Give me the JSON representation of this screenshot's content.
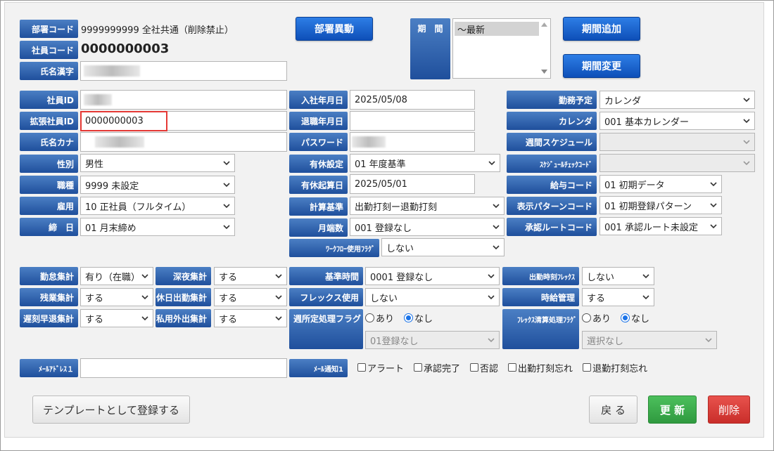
{
  "header": {
    "dept_code_label": "部署コード",
    "dept_code_value": "9999999999  全社共通（削除禁止）",
    "emp_code_label": "社員コード",
    "emp_code_value": "0000000003",
    "name_kanji_label": "氏名漢字",
    "dept_transfer_button": "部署異動",
    "period_label": "期　間",
    "period_option": "～最新",
    "add_period_button": "期間追加",
    "change_period_button": "期間変更"
  },
  "col1": {
    "emp_id_label": "社員ID",
    "ext_emp_id_label": "拡張社員ID",
    "ext_emp_id_value": "0000000003",
    "name_kana_label": "氏名カナ",
    "gender_label": "性別",
    "gender_value": "男性",
    "job_label": "職種",
    "job_value": "9999 未設定",
    "employment_label": "雇用",
    "employment_value": "10 正社員（フルタイム）",
    "closing_label": "締　日",
    "closing_value": "01 月末締め"
  },
  "col2": {
    "hire_date_label": "入社年月日",
    "hire_date_value": "2025/05/08",
    "retire_date_label": "退職年月日",
    "password_label": "パスワード",
    "paid_leave_label": "有休設定",
    "paid_leave_value": "01 年度基準",
    "paid_leave_start_label": "有休起算日",
    "paid_leave_start_value": "2025/05/01",
    "calc_basis_label": "計算基準",
    "calc_basis_value": "出勤打刻ー退勤打刻",
    "month_end_label": "月端数",
    "month_end_value": "001 登録なし",
    "workflow_label": "ﾜｰｸﾌﾛｰ使用ﾌﾗｸﾞ",
    "workflow_value": "しない"
  },
  "col3": {
    "work_schedule_label": "勤務予定",
    "work_schedule_value": "カレンダ",
    "calendar_label": "カレンダ",
    "calendar_value": "001 基本カレンダー",
    "weekly_schedule_label": "週間スケジュール",
    "schedule_check_label": "ｽｹｼﾞｭｰﾙﾁｪｯｸｺｰﾄﾞ",
    "salary_code_label": "給与コード",
    "salary_code_value": "01 初期データ",
    "display_pattern_label": "表示パターンコード",
    "display_pattern_value": "01 初期登録パターン",
    "approval_route_label": "承認ルートコード",
    "approval_route_value": "001 承認ルート未設定"
  },
  "aggregation": {
    "attendance_label": "勤怠集計",
    "attendance_value": "有り（在職）",
    "late_night_label": "深夜集計",
    "late_night_value": "する",
    "overtime_label": "残業集計",
    "overtime_value": "する",
    "holiday_work_label": "休日出勤集計",
    "holiday_work_value": "する",
    "late_early_label": "遅刻早退集計",
    "late_early_value": "する",
    "private_out_label": "私用外出集計",
    "private_out_value": "する",
    "base_time_label": "基準時間",
    "base_time_value": "0001 登録なし",
    "flex_use_label": "フレックス使用",
    "flex_use_value": "しない",
    "weekly_fixed_label": "週所定処理フラグ",
    "weekly_fixed_yes": "あり",
    "weekly_fixed_no": "なし",
    "weekly_fixed_select": "01登録なし",
    "clock_flex_label": "出勤時刻ﾌﾚｯｸｽ",
    "clock_flex_value": "しない",
    "hourly_label": "時給管理",
    "hourly_value": "する",
    "flex_settle_label": "ﾌﾚｯｸｽ清算処理ﾌﾗｸﾞ",
    "flex_settle_yes": "あり",
    "flex_settle_no": "なし",
    "flex_settle_select": "選択なし"
  },
  "mail": {
    "address_label": "ﾒｰﾙｱﾄﾞﾚｽ１",
    "notify_label": "ﾒｰﾙ通知1",
    "opt_alert": "アラート",
    "opt_approved": "承認完了",
    "opt_rejected": "否認",
    "opt_clockin_missed": "出勤打刻忘れ",
    "opt_clockout_missed": "退勤打刻忘れ"
  },
  "footer": {
    "template_button": "テンプレートとして登録する",
    "back_button": "戻 る",
    "update_button": "更 新",
    "delete_button": "削除"
  },
  "colors": {
    "label_blue": "#1f4f9c",
    "update_green": "#3aa84a",
    "delete_red": "#d93a36",
    "highlight_red": "#e53935"
  }
}
